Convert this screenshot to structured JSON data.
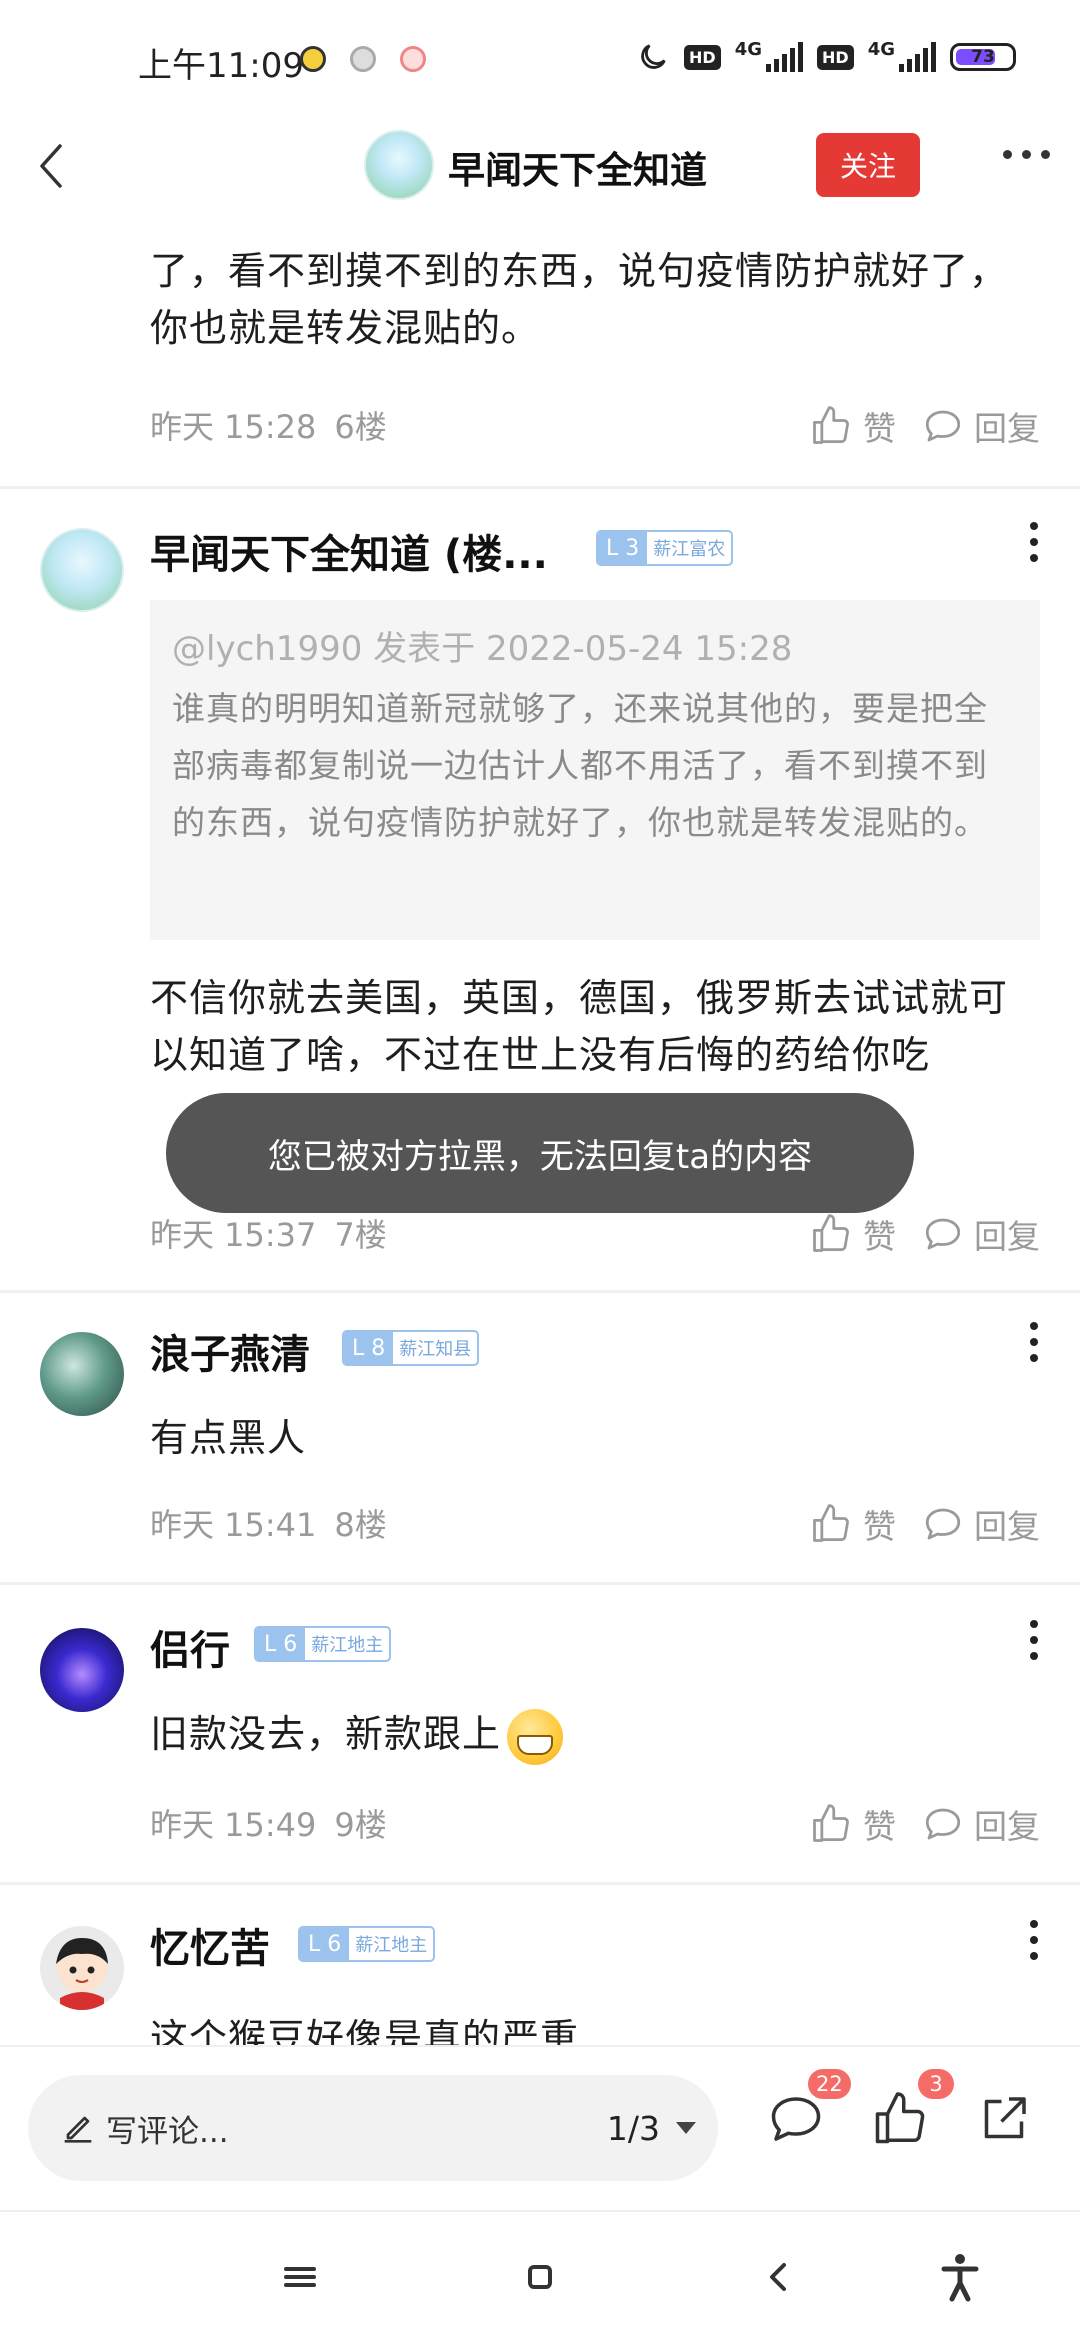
{
  "status_bar": {
    "time": "上午11:09",
    "hd1": "HD",
    "net1": "4G",
    "hd2": "HD",
    "net2": "4G",
    "battery": "73",
    "battery_level_percent": 73
  },
  "header": {
    "title": "早闻天下全知道",
    "follow_label": "关注"
  },
  "posts": [
    {
      "body_partial": "了，看不到摸不到的东西，说句疫情防护就好了，你也就是转发混贴的。",
      "time": "昨天 15:28",
      "floor": "6楼"
    },
    {
      "username": "早闻天下全知道 (楼...",
      "level": "L 3",
      "title": "薪江富农",
      "quote_header": "@lych1990 发表于 2022-05-24 15:28",
      "quote_text": "谁真的明明知道新冠就够了，还来说其他的，要是把全部病毒都复制说一边估计人都不用活了，看不到摸不到的东西，说句疫情防护就好了，你也就是转发混贴的。",
      "body": "不信你就去美国，英国，德国，俄罗斯去试试就可以知道了啥，不过在世上没有后悔的药给你吃",
      "time": "昨天 15:37",
      "floor": "7楼"
    },
    {
      "username": "浪子燕清",
      "level": "L 8",
      "title": "薪江知县",
      "body": "有点黑人",
      "time": "昨天 15:41",
      "floor": "8楼"
    },
    {
      "username": "侣行",
      "level": "L 6",
      "title": "薪江地主",
      "body": "旧款没去，新款跟上",
      "time": "昨天 15:49",
      "floor": "9楼"
    },
    {
      "username": "忆忆苦",
      "level": "L 6",
      "title": "薪江地主",
      "body": "这个猴豆好像是真的严重"
    }
  ],
  "actions": {
    "like": "赞",
    "reply": "回复"
  },
  "toast": "您已被对方拉黑，无法回复ta的内容",
  "bottom_bar": {
    "comment_placeholder": "写评论...",
    "pager": "1/3",
    "comment_count": "22",
    "like_count": "3"
  }
}
